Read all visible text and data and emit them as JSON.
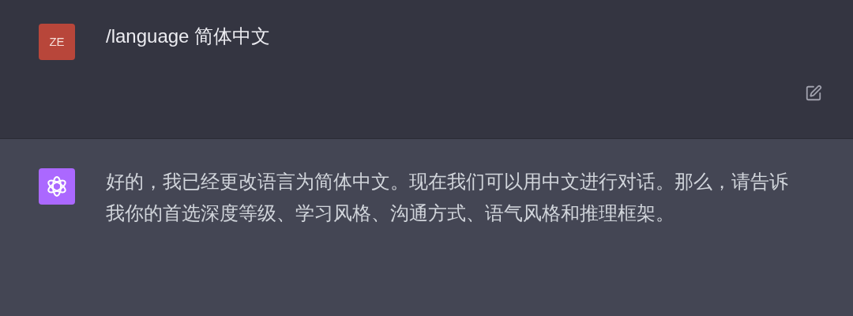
{
  "messages": [
    {
      "kind": "user",
      "avatar": "ZE",
      "text": "/language 简体中文"
    },
    {
      "kind": "assistant",
      "text": "好的，我已经更改语言为简体中文。现在我们可以用中文进行对话。那么，请告诉我你的首选深度等级、学习风格、沟通方式、语气风格和推理框架。"
    }
  ]
}
